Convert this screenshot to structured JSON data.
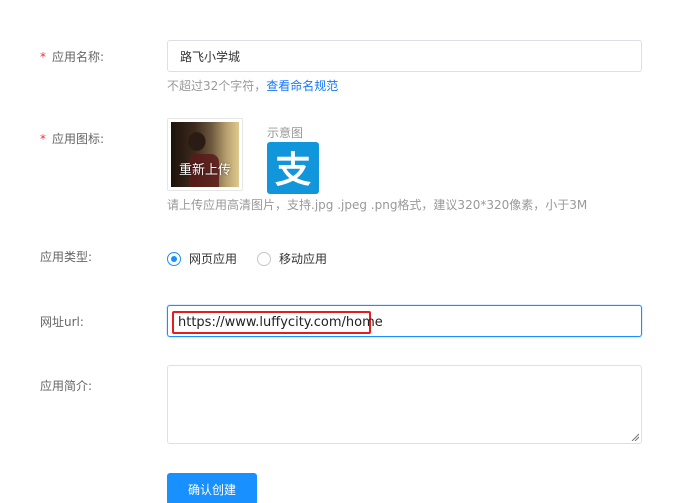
{
  "form": {
    "app_name": {
      "required_mark": "*",
      "label": "应用名称:",
      "value": "路飞小学城",
      "hint_text": "不超过32个字符，",
      "hint_link": "查看命名规范"
    },
    "app_icon": {
      "required_mark": "*",
      "label": "应用图标:",
      "reupload_text": "重新上传",
      "sample_label": "示意图",
      "sample_icon_glyph": "支",
      "upload_hint": "请上传应用高清图片，支持.jpg .jpeg .png格式，建议320*320像素，小于3M"
    },
    "app_type": {
      "label": "应用类型:",
      "options": [
        {
          "label": "网页应用",
          "checked": true
        },
        {
          "label": "移动应用",
          "checked": false
        }
      ]
    },
    "url": {
      "label": "网址url:",
      "value": "https://www.luffycity.com/home"
    },
    "description": {
      "label": "应用简介:",
      "value": ""
    },
    "submit_label": "确认创建"
  },
  "colors": {
    "primary": "#1890ff",
    "required": "#e8343f",
    "highlight_border": "#e02020",
    "alipay_blue": "#1296db"
  }
}
